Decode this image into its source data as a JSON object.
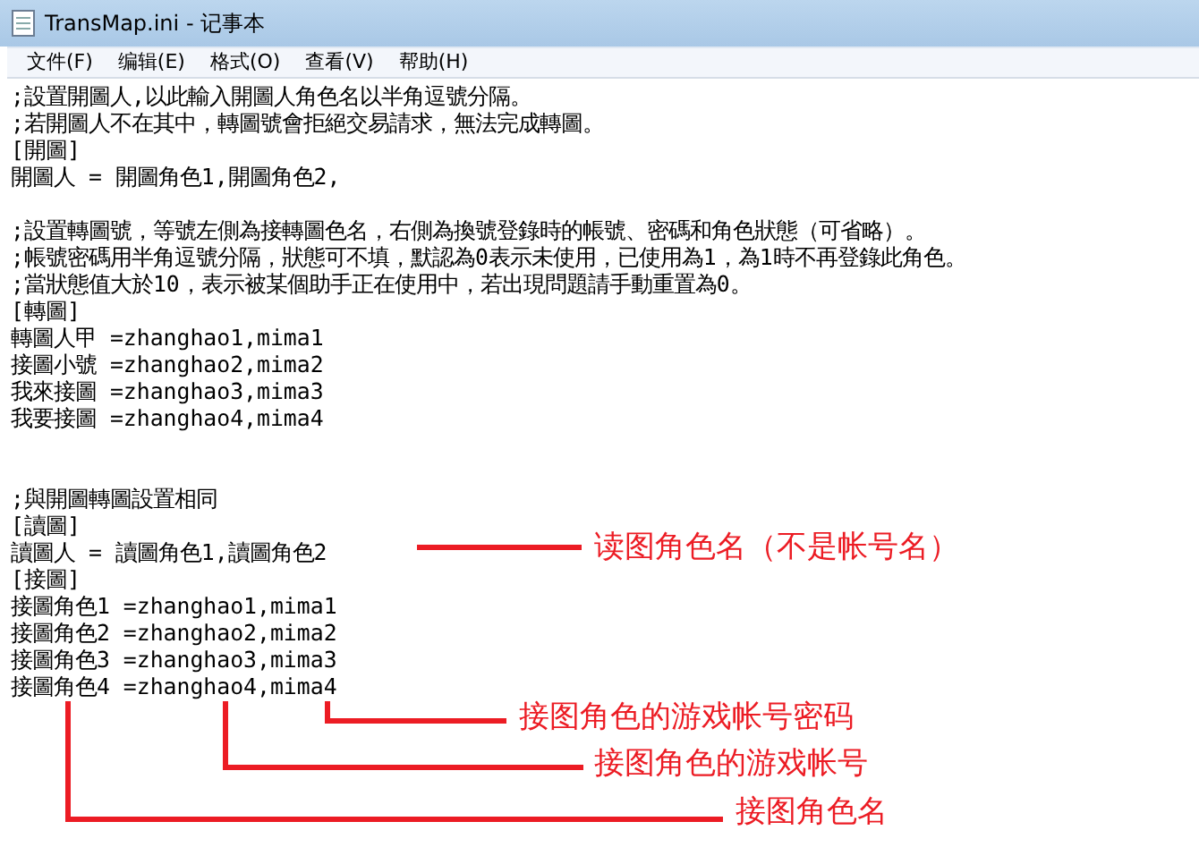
{
  "window": {
    "title": "TransMap.ini - 记事本"
  },
  "menu": [
    "文件(F)",
    "编辑(E)",
    "格式(O)",
    "查看(V)",
    "帮助(H)"
  ],
  "lines": [
    {
      "kind": "text",
      "text": ";設置開圖人,以此輸入開圖人角色名以半角逗號分隔。"
    },
    {
      "kind": "text",
      "text": ";若開圖人不在其中，轉圖號會拒絕交易請求，無法完成轉圖。"
    },
    {
      "kind": "text",
      "text": "[開圖]"
    },
    {
      "kind": "text",
      "text": "開圖人 = 開圖角色1,開圖角色2,"
    },
    {
      "kind": "blank"
    },
    {
      "kind": "text",
      "text": ";設置轉圖號，等號左側為接轉圖色名，右側為換號登錄時的帳號、密碼和角色狀態（可省略）。"
    },
    {
      "kind": "text",
      "text": ";帳號密碼用半角逗號分隔，狀態可不填，默認為0表示未使用，已使用為1，為1時不再登錄此角色。"
    },
    {
      "kind": "text",
      "text": ";當狀態值大於10，表示被某個助手正在使用中，若出現問題請手動重置為0。"
    },
    {
      "kind": "text",
      "text": "[轉圖]"
    },
    {
      "kind": "text",
      "text": "轉圖人甲 =zhanghao1,mima1"
    },
    {
      "kind": "text",
      "text": "接圖小號 =zhanghao2,mima2"
    },
    {
      "kind": "text",
      "text": "我來接圖 =zhanghao3,mima3"
    },
    {
      "kind": "text",
      "text": "我要接圖 =zhanghao4,mima4"
    },
    {
      "kind": "blank"
    },
    {
      "kind": "blank"
    },
    {
      "kind": "text",
      "text": ";與開圖轉圖設置相同"
    },
    {
      "kind": "text",
      "text": "[讀圖]"
    },
    {
      "kind": "text",
      "text": "讀圖人 = 讀圖角色1,讀圖角色2"
    },
    {
      "kind": "text",
      "text": "[接圖]"
    },
    {
      "kind": "text",
      "text": "接圖角色1 =zhanghao1,mima1"
    },
    {
      "kind": "text",
      "text": "接圖角色2 =zhanghao2,mima2"
    },
    {
      "kind": "text",
      "text": "接圖角色3 =zhanghao3,mima3"
    },
    {
      "kind": "text",
      "text": "接圖角色4 =zhanghao4,mima4"
    }
  ],
  "annotations": [
    {
      "text": "读图角色名（不是帐号名）"
    },
    {
      "text": "接图角色的游戏帐号密码"
    },
    {
      "text": "接图角色的游戏帐号"
    },
    {
      "text": "接图角色名"
    }
  ]
}
